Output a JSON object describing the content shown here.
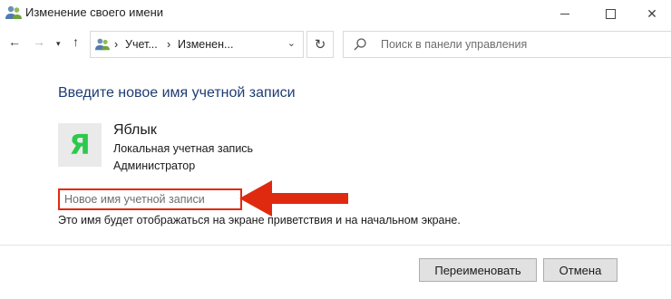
{
  "window": {
    "title": "Изменение своего имени",
    "icon": "users-icon"
  },
  "nav": {
    "back_icon": "back-arrow-icon",
    "forward_icon": "forward-arrow-icon",
    "history_icon": "chevron-down-icon",
    "up_icon": "up-arrow-icon",
    "breadcrumb": [
      "Учет...",
      "Изменен..."
    ],
    "refresh_icon": "refresh-icon",
    "search": {
      "placeholder": "Поиск в панели управления"
    }
  },
  "content": {
    "heading": "Введите новое имя учетной записи",
    "account": {
      "avatar_letter": "Я",
      "avatar_color": "#2dc84d",
      "name": "Яблык",
      "type": "Локальная учетная запись",
      "role": "Администратор"
    },
    "new_name_input": {
      "placeholder": "Новое имя учетной записи",
      "value": ""
    },
    "hint": "Это имя будет отображаться на экране приветствия и на начальном экране.",
    "highlight_color": "#e02a10"
  },
  "buttons": {
    "rename": "Переименовать",
    "cancel": "Отмена"
  }
}
